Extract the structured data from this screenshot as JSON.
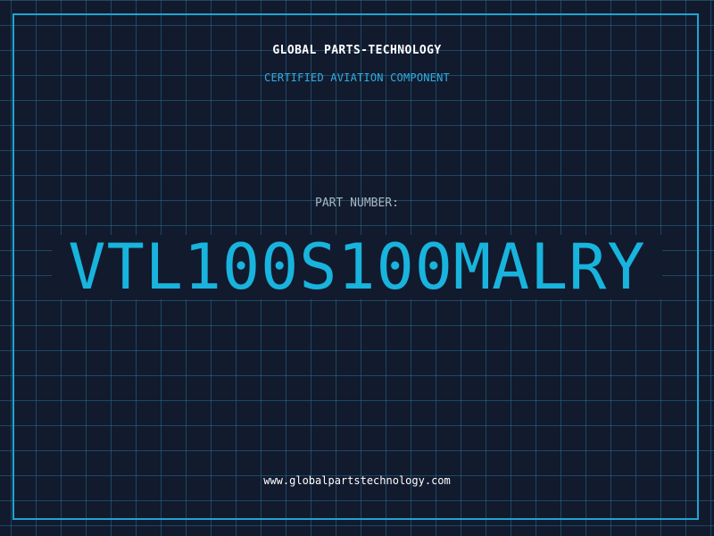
{
  "header": {
    "brand": "GLOBAL PARTS-TECHNOLOGY",
    "subtitle": "CERTIFIED AVIATION COMPONENT"
  },
  "main": {
    "part_label": "PART NUMBER:",
    "part_number": "VTL100S100MALRY"
  },
  "footer": {
    "url": "www.globalpartstechnology.com"
  },
  "colors": {
    "background": "#121a2e",
    "grid": "#266e8c",
    "accent": "#1ba6d2",
    "part_number": "#18b4dd",
    "label": "#a7b6c5",
    "text": "#ffffff"
  }
}
